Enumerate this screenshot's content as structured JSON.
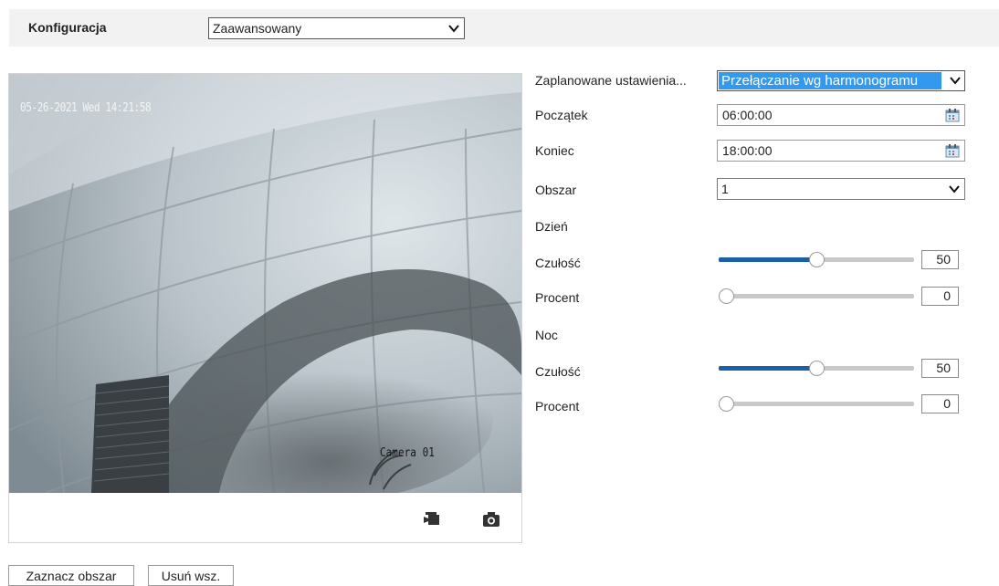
{
  "topbar": {
    "config_label": "Konfiguracja",
    "mode_value": "Zaawansowany"
  },
  "video": {
    "osd_time": "05-26-2021 Wed 14:21:58",
    "osd_camera": "Camera 01",
    "toolbar": {
      "record_icon": "video-record-icon",
      "snapshot_icon": "camera-snapshot-icon"
    }
  },
  "buttons": {
    "mark_area": "Zaznacz obszar",
    "clear_all": "Usuń wsz."
  },
  "settings": {
    "schedule_label": "Zaplanowane ustawienia...",
    "schedule_value": "Przełączanie wg harmonogramu",
    "start_label": "Początek",
    "start_value": "06:00:00",
    "end_label": "Koniec",
    "end_value": "18:00:00",
    "area_label": "Obszar",
    "area_value": "1",
    "day_label": "Dzień",
    "day": {
      "sensitivity_label": "Czułość",
      "sensitivity": 50,
      "sensitivity_text": "50",
      "percent_label": "Procent",
      "percent": 0,
      "percent_text": "0"
    },
    "night_label": "Noc",
    "night": {
      "sensitivity_label": "Czułość",
      "sensitivity": 50,
      "sensitivity_text": "50",
      "percent_label": "Procent",
      "percent": 0,
      "percent_text": "0"
    }
  },
  "colors": {
    "accent": "#1b5ea9",
    "selection": "#3399ee",
    "topbar_bg": "#f2f2f2"
  }
}
